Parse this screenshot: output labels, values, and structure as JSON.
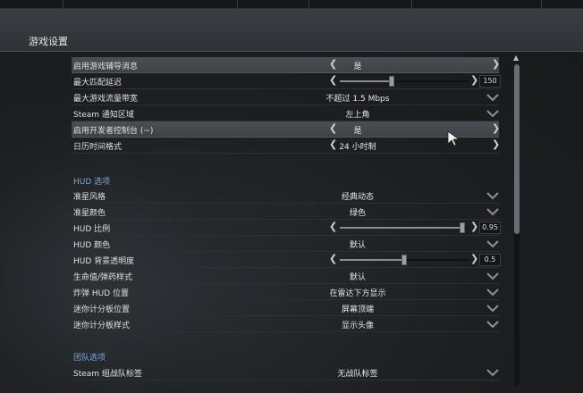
{
  "window": {
    "title": "游戏设置"
  },
  "settings_top": [
    {
      "label": "启用游戏辅导消息",
      "value": "是",
      "control": "arrows",
      "highlight": true
    },
    {
      "label": "最大匹配延迟",
      "value": "150",
      "control": "slider",
      "level": 0.4
    },
    {
      "label": "最大游戏流量带宽",
      "value": "不超过 1.5 Mbps",
      "control": "dropdown"
    },
    {
      "label": "Steam 通知区域",
      "value": "左上角",
      "control": "dropdown"
    },
    {
      "label": "启用开发者控制台 (~)",
      "value": "是",
      "control": "arrows",
      "highlight": true
    },
    {
      "label": "日历时间格式",
      "value": "24 小时制",
      "control": "arrows"
    }
  ],
  "hud": {
    "title": "HUD 选项",
    "items": [
      {
        "label": "准星风格",
        "value": "经典动态",
        "control": "dropdown"
      },
      {
        "label": "准星颜色",
        "value": "绿色",
        "control": "dropdown"
      },
      {
        "label": "HUD 比例",
        "value": "0.95",
        "control": "slider",
        "level": 0.95
      },
      {
        "label": "HUD 颜色",
        "value": "默认",
        "control": "dropdown"
      },
      {
        "label": "HUD 背景透明度",
        "value": "0.5",
        "control": "slider",
        "level": 0.5
      },
      {
        "label": "生命值/弹药样式",
        "value": "默认",
        "control": "dropdown"
      },
      {
        "label": "炸弹 HUD 位置",
        "value": "在雷达下方显示",
        "control": "dropdown"
      },
      {
        "label": "迷你计分板位置",
        "value": "屏幕顶端",
        "control": "dropdown"
      },
      {
        "label": "迷你计分板样式",
        "value": "显示头像",
        "control": "dropdown"
      }
    ]
  },
  "team": {
    "title": "团队选项",
    "items": [
      {
        "label": "Steam 组战队标签",
        "value": "无战队标签",
        "control": "dropdown"
      }
    ]
  },
  "glyphs": {
    "arrow_left": "❮",
    "arrow_right": "❯",
    "scroll_up": "▲"
  },
  "colors": {
    "section": "#7aa6d6",
    "highlight": "#4b4f55",
    "background": "#1b1d20"
  }
}
